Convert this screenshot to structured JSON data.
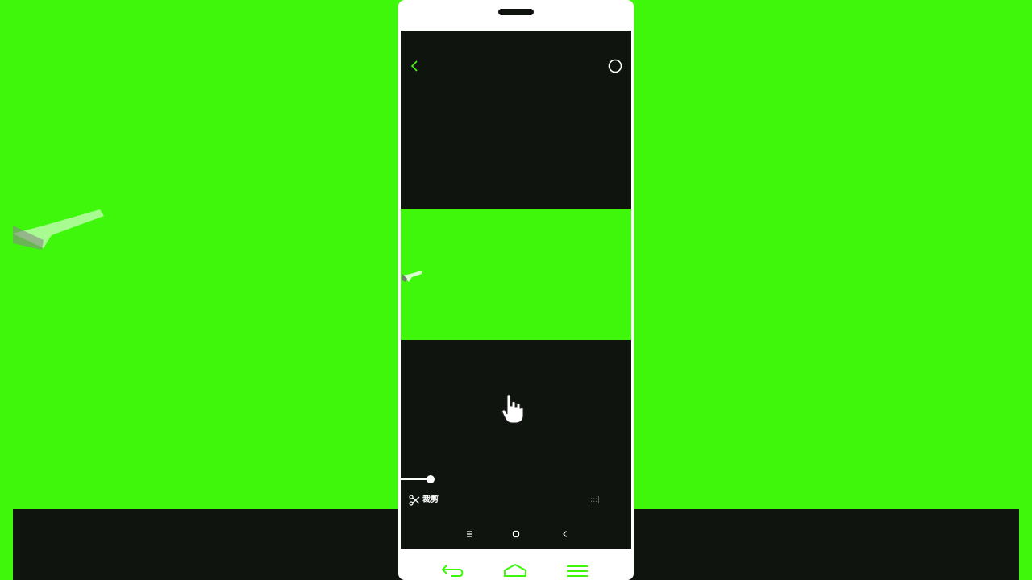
{
  "colors": {
    "chroma_green": "#3ef70b",
    "screen_dark": "#0f140f",
    "phone_frame": "#ffffff"
  },
  "toolbar": {
    "back_icon": "chevron-left-icon",
    "options_icon": "circle-icon"
  },
  "player": {
    "progress_fraction": 0.12
  },
  "edit_bar": {
    "cut_icon": "scissors-icon",
    "cut_label": "裁剪",
    "right_label": "|:::|"
  },
  "soft_nav": {
    "items": [
      "menu-icon",
      "home-icon",
      "back-icon"
    ]
  },
  "hardware_nav": {
    "items": [
      "back-arrow-icon",
      "home-icon",
      "menu-icon"
    ]
  }
}
